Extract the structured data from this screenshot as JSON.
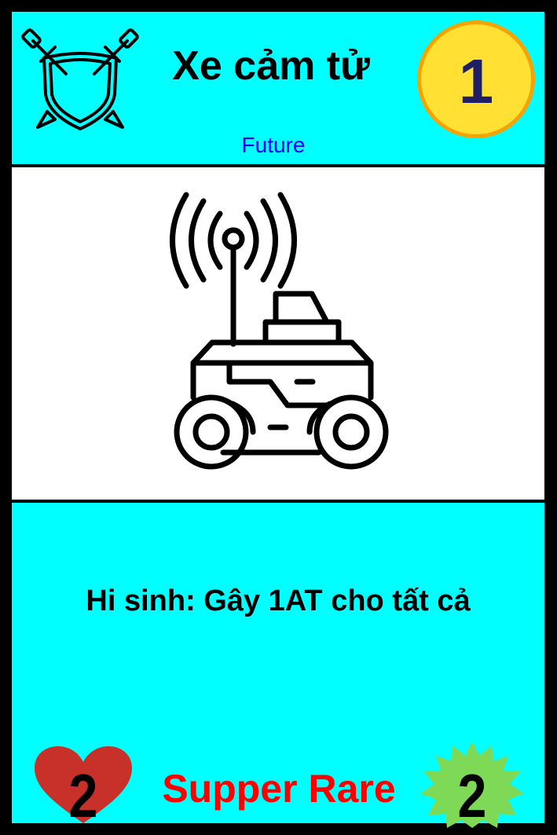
{
  "card": {
    "title": "Xe cảm tử",
    "faction": "Future",
    "cost": "1",
    "ability": "Hi sinh: Gây 1AT cho tất cả",
    "rarity": "Supper Rare",
    "hp": "2",
    "attack": "2"
  },
  "icons": {
    "class": "shield-swords-icon",
    "art": "robot-rover-antenna-icon",
    "hp": "heart-icon",
    "attack": "starburst-icon"
  },
  "colors": {
    "border": "#000000",
    "panel": "#00ffff",
    "art_bg": "#ffffff",
    "coin_fill": "#ffe033",
    "coin_ring": "#f5a300",
    "cost_text": "#1f1f66",
    "faction_text": "#0000ff",
    "rarity_text": "#ff0000",
    "heart": "#c8302a",
    "burst": "#7ed957"
  }
}
